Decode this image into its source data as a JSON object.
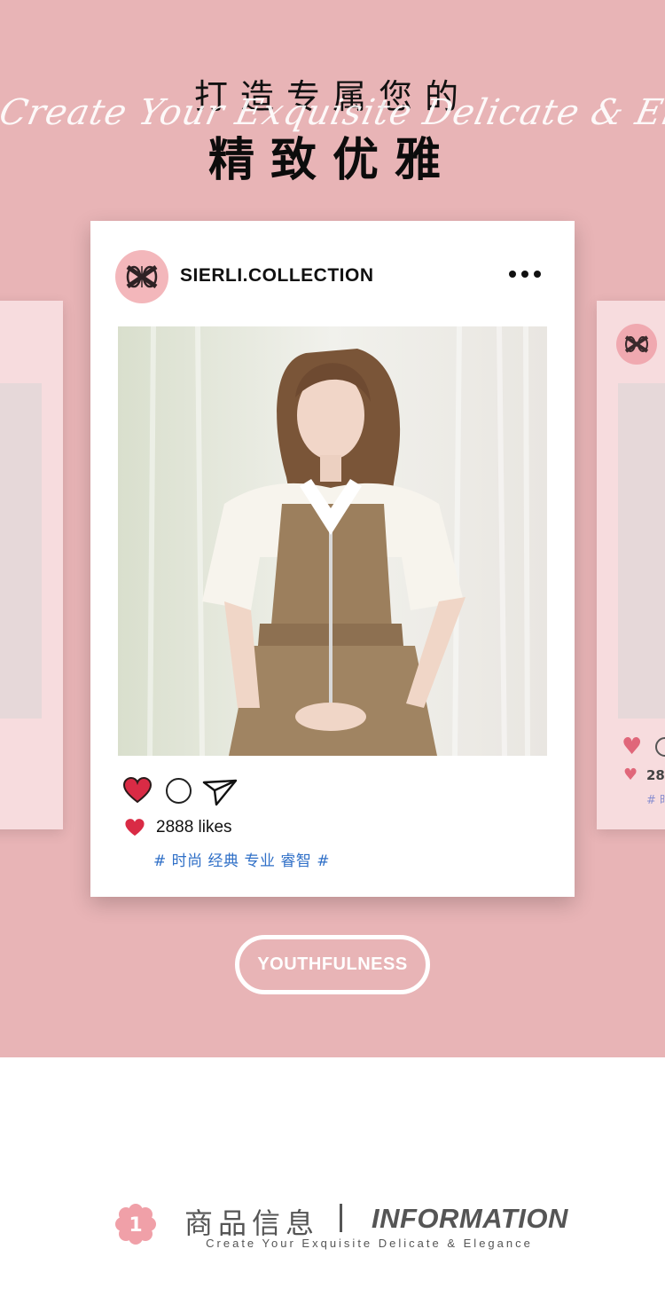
{
  "hero": {
    "title_top": "打造专属您的",
    "script_line": "Create Your Exquisite Delicate & Elegance",
    "title_main": "精致优雅",
    "background_color": "#e8b4b6"
  },
  "post": {
    "handle": "SIERLI.COLLECTION",
    "likes": "2888 likes",
    "tags": "# 时尚 经典 专业 睿智 #",
    "heart_color": "#d92b45",
    "tag_color": "#2f6fc7"
  },
  "side_right": {
    "likes_partial": "28",
    "tags_partial": "# 时"
  },
  "badge": {
    "label": "YOUTHFULNESS"
  },
  "section": {
    "number": "1",
    "title_cn": "商品信息",
    "title_en": "INFORMATION",
    "subtitle": "Create Your Exquisite Delicate & Elegance"
  },
  "icons": [
    "brand-logo-icon",
    "more-icon",
    "heart-icon",
    "comment-icon",
    "send-icon",
    "flower-badge-icon"
  ]
}
